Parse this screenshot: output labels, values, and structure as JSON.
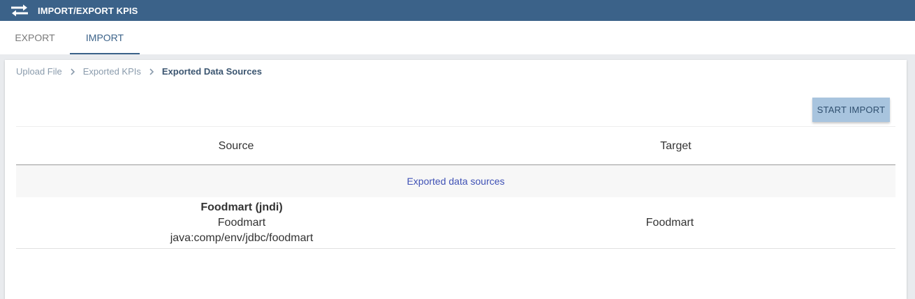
{
  "header": {
    "title": "IMPORT/EXPORT KPIS",
    "icon": "swap-arrows-icon",
    "color": "#3b6289"
  },
  "tabs": [
    {
      "label": "EXPORT",
      "active": false
    },
    {
      "label": "IMPORT",
      "active": true
    }
  ],
  "breadcrumb": [
    "Upload File",
    "Exported KPIs",
    "Exported Data Sources"
  ],
  "actions": {
    "start_import": "START IMPORT"
  },
  "table": {
    "columns": [
      "Source",
      "Target"
    ],
    "group_label": "Exported data sources",
    "rows": [
      {
        "source_name": "Foodmart (jndi)",
        "source_label": "Foodmart",
        "source_jndi": "java:comp/env/jdbc/foodmart",
        "target": "Foodmart"
      }
    ]
  }
}
